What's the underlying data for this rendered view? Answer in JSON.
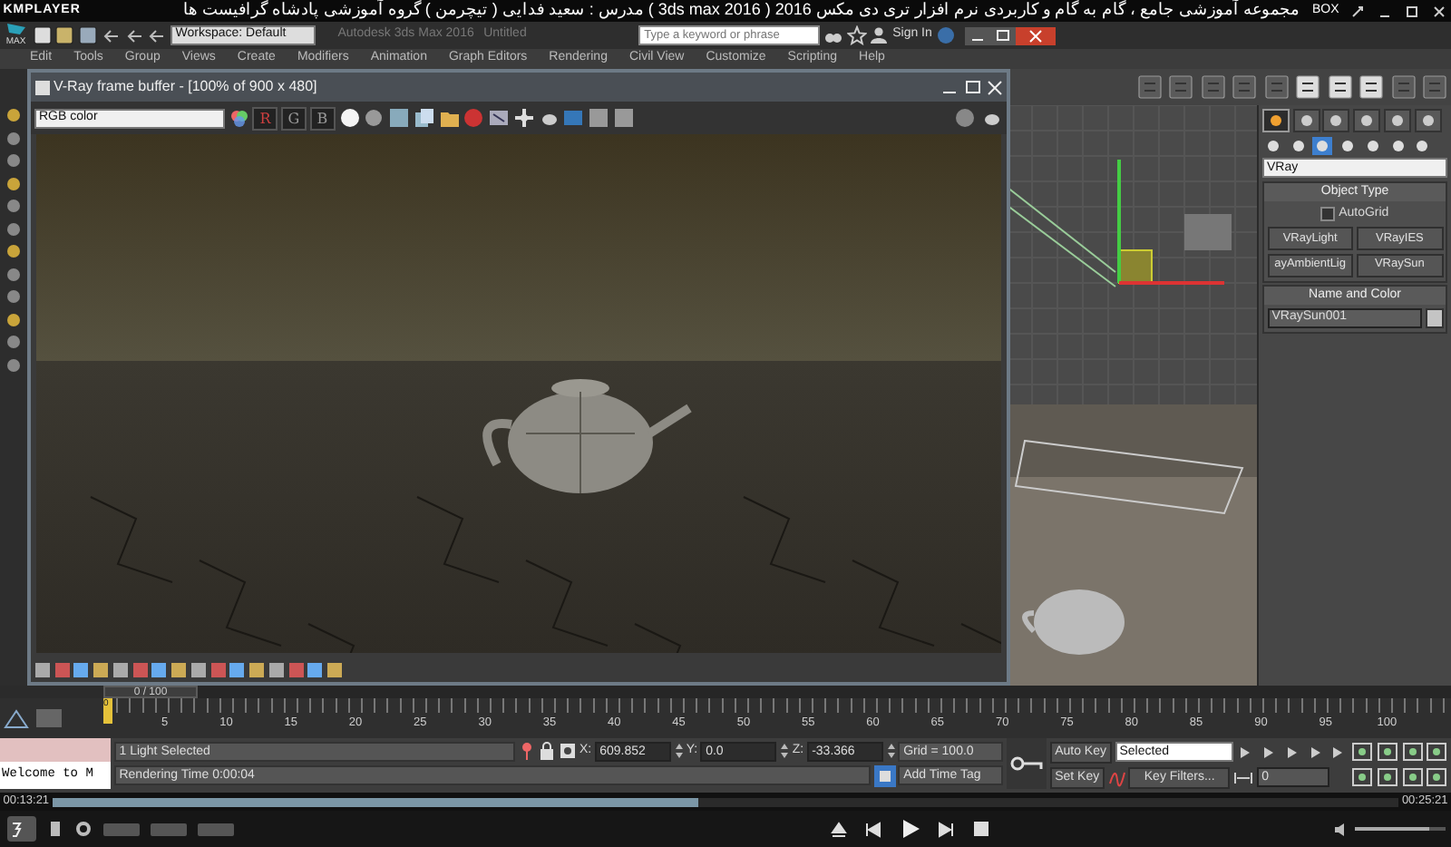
{
  "player": {
    "brand": "KMPLAYER",
    "title": "مجموعه آموزشی جامع ، گام به گام و کاربردی نرم افزار تری دی مکس 2016 ( 3ds max 2016 )  مدرس : سعید فدایی ( تیچرمن ) گروه آموزشی پادشاه گرافیست ها",
    "box_label": "BOX"
  },
  "app": {
    "logo": "MAX",
    "workspace": "Workspace: Default",
    "app_title": "Autodesk 3ds Max 2016",
    "document": "Untitled",
    "search": {
      "placeholder": "Type a keyword or phrase"
    },
    "sign_in": "Sign In"
  },
  "menu": [
    "Edit",
    "Tools",
    "Group",
    "Views",
    "Create",
    "Modifiers",
    "Animation",
    "Graph Editors",
    "Rendering",
    "Civil View",
    "Customize",
    "Scripting",
    "Help"
  ],
  "frame_buffer": {
    "title": "V-Ray frame buffer - [100% of 900 x 480]",
    "channel": "RGB color",
    "channel_buttons": [
      {
        "label": "R",
        "color": "#d04040"
      },
      {
        "label": "G",
        "color": "#9a9a9a"
      },
      {
        "label": "B",
        "color": "#9a9a9a"
      }
    ]
  },
  "command_panel": {
    "tabs": [
      {
        "selected": true
      },
      {
        "selected": false
      },
      {
        "selected": false
      },
      {
        "selected": false
      },
      {
        "selected": false
      },
      {
        "selected": false
      }
    ],
    "categories": [
      {
        "selected": false
      },
      {
        "selected": false
      },
      {
        "selected": true
      },
      {
        "selected": false
      },
      {
        "selected": false
      },
      {
        "selected": false
      },
      {
        "selected": false
      }
    ],
    "renderer": "VRay",
    "object_type": {
      "title": "Object Type",
      "autogrid": {
        "label": "AutoGrid",
        "checked": false
      },
      "buttons": [
        "VRayLight",
        "VRayIES",
        "ayAmbientLig",
        "VRaySun"
      ]
    },
    "name_and_color": {
      "title": "Name and Color",
      "name": "VRaySun001",
      "color": "#c4c4c4"
    }
  },
  "time_slider": {
    "label": "0 / 100",
    "level": 0
  },
  "timeline": {
    "current": "0",
    "ticks": [
      "5",
      "10",
      "15",
      "20",
      "25",
      "30",
      "35",
      "40",
      "45",
      "50",
      "55",
      "60",
      "65",
      "70",
      "75",
      "80",
      "85",
      "90",
      "95",
      "100"
    ]
  },
  "status": {
    "listener": "Welcome to M",
    "selection": "1 Light Selected",
    "prompt": "Rendering Time  0:00:04",
    "coords": [
      {
        "axis": "X:",
        "value": "609.852"
      },
      {
        "axis": "Y:",
        "value": "0.0"
      },
      {
        "axis": "Z:",
        "value": "-33.366"
      }
    ],
    "grid": "Grid = 100.0",
    "add_time_tag": "Add Time Tag",
    "auto_key": "Auto Key",
    "key_mode": "Selected",
    "set_key": "Set Key",
    "key_filters": "Key Filters...",
    "frame": "0"
  },
  "playback": {
    "elapsed": "00:13:21",
    "total": "00:25:21",
    "progress": {
      "level": 0.48
    },
    "volume": {
      "level": 0.82
    }
  }
}
